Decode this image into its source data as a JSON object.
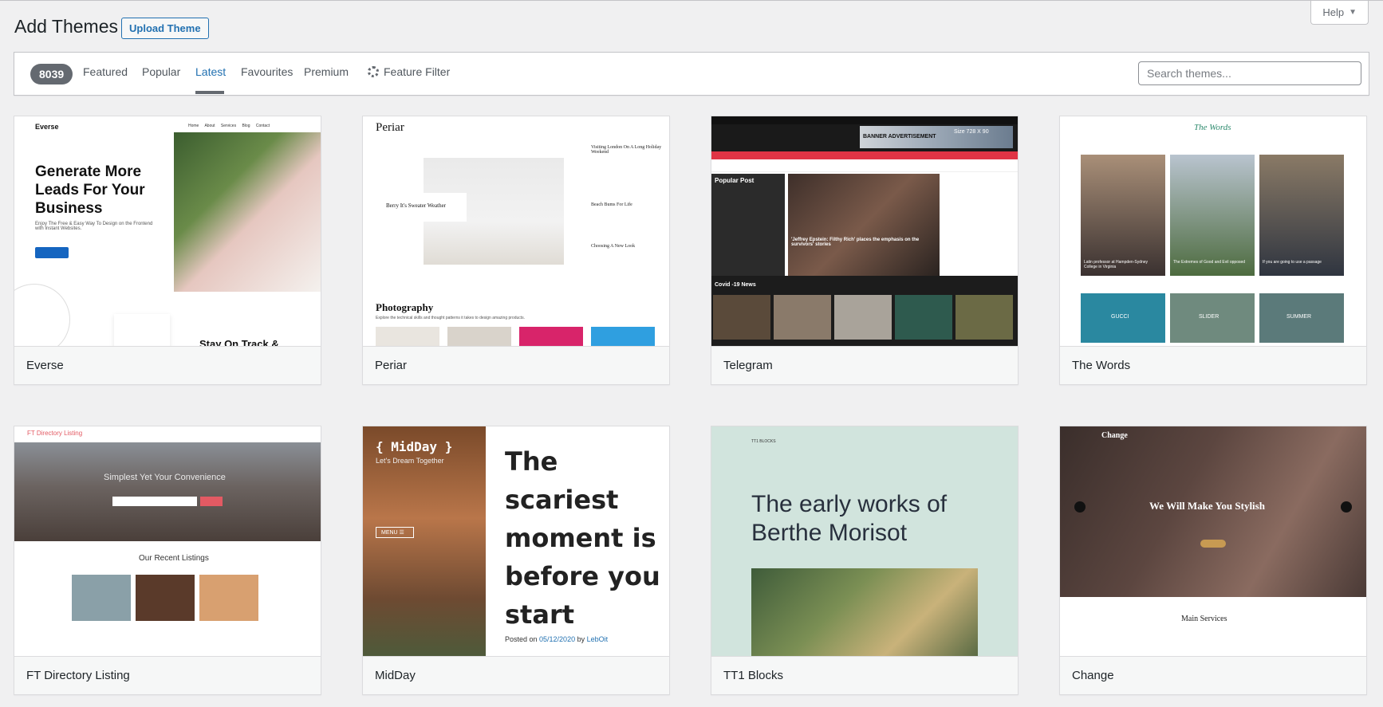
{
  "header": {
    "title": "Add Themes",
    "upload_label": "Upload Theme",
    "help_label": "Help"
  },
  "filter_bar": {
    "count": "8039",
    "tabs": [
      {
        "label": "Featured"
      },
      {
        "label": "Popular"
      },
      {
        "label": "Latest",
        "active": true
      },
      {
        "label": "Favourites"
      },
      {
        "label": "Premium"
      }
    ],
    "feature_filter_label": "Feature Filter",
    "search_placeholder": "Search themes..."
  },
  "themes": [
    {
      "name": "Everse",
      "preview": {
        "logo": "Everse",
        "headline": "Generate More Leads For Your Business",
        "tagline": "Enjoy The Free & Easy Way To Design on the Frontend with Instant Websites.",
        "footer_text": "Stay On Track &"
      }
    },
    {
      "name": "Periar",
      "preview": {
        "logo": "Periar",
        "caption": "Berry It's Sweater Weather",
        "side_items": [
          "Visiting London On A Long Holiday Weekend",
          "Beach Bums For Life",
          "Choosing A New Look"
        ],
        "section": "Photography",
        "section_text": "Explore the technical skills and thought patterns it takes to design amazing products."
      }
    },
    {
      "name": "Telegram",
      "preview": {
        "ad_text": "BANNER ADVERTISEMENT",
        "ad_size": "Size 728 X 90",
        "popular": "Popular Post",
        "headline": "'Jeffrey Epstein: Filthy Rich' places the emphasis on the survivors' stories",
        "covid": "Covid -19 News"
      }
    },
    {
      "name": "The Words",
      "preview": {
        "logo": "The Words",
        "captions": [
          "Latin professor at Hampden-Sydney College in Virginia",
          "The Extremes of Good and Evil opposed",
          "If you are going to use a passage"
        ],
        "tiles": [
          "GUCCI",
          "SLIDER",
          "SUMMER"
        ]
      }
    },
    {
      "name": "FT Directory Listing",
      "preview": {
        "logo": "FT Directory Listing",
        "hero_title": "Simplest Yet Your Convenience",
        "section": "Our Recent Listings"
      }
    },
    {
      "name": "MidDay",
      "preview": {
        "logo": "{ MidDay }",
        "tagline": "Let's Dream Together",
        "menu": "MENU ☰",
        "headline": "The scariest moment is before you start",
        "posted_prefix": "Posted on ",
        "posted_date": "05/12/2020",
        "posted_by": " by ",
        "author": "LebOit"
      }
    },
    {
      "name": "TT1 Blocks",
      "preview": {
        "site_title": "TT1 BLOCKS",
        "headline": "The early works of Berthe Morisot"
      }
    },
    {
      "name": "Change",
      "preview": {
        "logo": "Change",
        "headline": "We Will Make You Stylish",
        "section": "Main Services"
      }
    }
  ]
}
